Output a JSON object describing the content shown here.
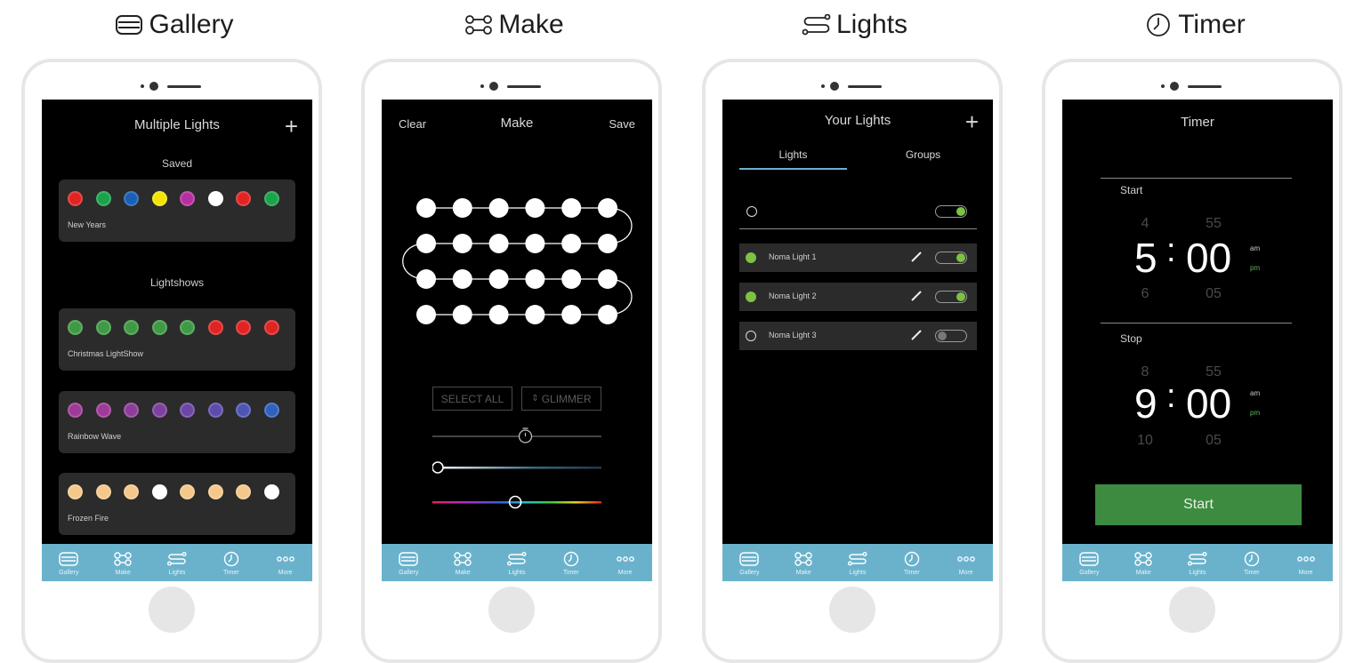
{
  "headings": {
    "gallery": "Gallery",
    "make": "Make",
    "lights": "Lights",
    "timer": "Timer"
  },
  "tabbar": [
    {
      "label": "Gallery",
      "icon": "gallery-icon"
    },
    {
      "label": "Make",
      "icon": "make-icon"
    },
    {
      "label": "Lights",
      "icon": "lights-icon"
    },
    {
      "label": "Timer",
      "icon": "timer-icon"
    },
    {
      "label": "More",
      "icon": "more-icon"
    }
  ],
  "gallery": {
    "title": "Multiple Lights",
    "saved_label": "Saved",
    "lightshows_label": "Lightshows",
    "cards": [
      {
        "name": "New Years",
        "colors": [
          "#e02424",
          "#1aa34a",
          "#1a5fb4",
          "#f2e300",
          "#b62fa0",
          "#ffffff",
          "#e02424",
          "#1aa34a"
        ]
      },
      {
        "name": "Christmas LightShow",
        "colors": [
          "#3f9a45",
          "#3f9a45",
          "#3f9a45",
          "#3f9a45",
          "#3f9a45",
          "#e02424",
          "#e02424",
          "#e02424"
        ]
      },
      {
        "name": "Rainbow Wave",
        "colors": [
          "#9e3a98",
          "#9e3a98",
          "#8e3e9a",
          "#7e409e",
          "#6e46a6",
          "#5e4cac",
          "#4e56b4",
          "#2f62bc"
        ]
      },
      {
        "name": "Frozen Fire",
        "colors": [
          "#f4c88a",
          "#f4c88a",
          "#f4c88a",
          "#ffffff",
          "#f4c88a",
          "#f4c88a",
          "#f4c88a",
          "#ffffff"
        ]
      }
    ]
  },
  "make": {
    "clear_label": "Clear",
    "title": "Make",
    "save_label": "Save",
    "select_all_label": "SELECT ALL",
    "glimmer_label": "GLIMMER",
    "speed_value": 0.55,
    "brightness_value": 0.02,
    "hue_value": 0.49
  },
  "lights": {
    "title": "Your Lights",
    "tabs": [
      "Lights",
      "Groups"
    ],
    "master_toggle_on": true,
    "rows": [
      {
        "name": "Noma Light 1",
        "on": true
      },
      {
        "name": "Noma Light 2",
        "on": true
      },
      {
        "name": "Noma Light 3",
        "on": false
      }
    ],
    "accent": "#7cc243"
  },
  "timer": {
    "title": "Timer",
    "start_section": "Start",
    "stop_section": "Stop",
    "start_time": {
      "hour_prev": "4",
      "hour": "5",
      "hour_next": "6",
      "min_prev": "55",
      "min": "00",
      "min_next": "05"
    },
    "stop_time": {
      "hour_prev": "8",
      "hour": "9",
      "hour_next": "10",
      "min_prev": "55",
      "min": "00",
      "min_next": "05"
    },
    "colon": ":",
    "am": "am",
    "pm": "pm",
    "start_button": "Start"
  }
}
